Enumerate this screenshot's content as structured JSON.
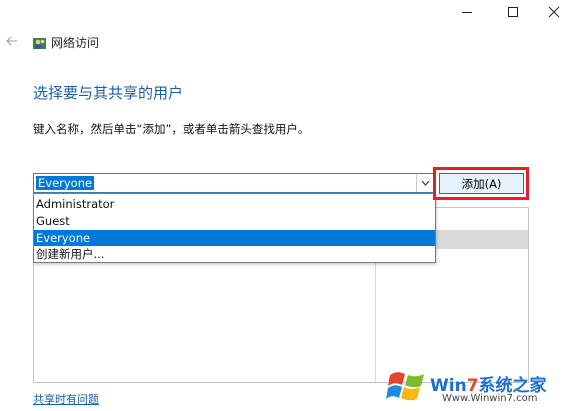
{
  "window": {
    "title": "网络访问",
    "controls": [
      "minimize",
      "maximize",
      "close"
    ]
  },
  "nav": {
    "back_icon": "arrow-left-icon"
  },
  "heading": "选择要与其共享的用户",
  "instruction": "键入名称，然后单击“添加”，或者单击箭头查找用户。",
  "combo": {
    "value": "Everyone"
  },
  "dropdown": {
    "options": [
      "Administrator",
      "Guest",
      "Everyone",
      "创建新用户..."
    ],
    "selected_index": 2
  },
  "add_button": {
    "label": "添加(A)",
    "highlight_color": "#e0202e"
  },
  "help_link": "共享时有问题",
  "watermark": {
    "brand_parts": [
      "Win",
      "7",
      "系统之家"
    ],
    "url": "Www.Winwin7.com"
  },
  "colors": {
    "accent": "#0078d7",
    "heading": "#1a5fa8"
  }
}
